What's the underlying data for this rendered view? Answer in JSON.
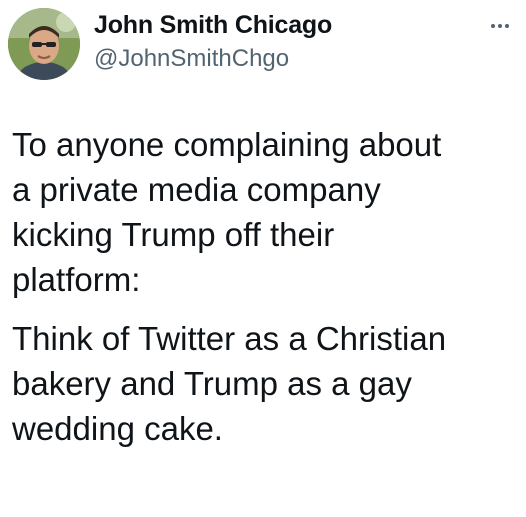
{
  "author": {
    "display_name": "John Smith Chicago",
    "handle": "@JohnSmithChgo",
    "avatar_icon": "profile-photo"
  },
  "more_icon": "more-dots-icon",
  "tweet": {
    "paragraph_1": "To anyone complaining about\na private media company\nkicking Trump off their\nplatform:",
    "paragraph_2": "Think of Twitter as a Christian\nbakery and Trump as a gay\nwedding cake."
  },
  "colors": {
    "text_primary": "#0f1419",
    "text_secondary": "#536471",
    "background": "#ffffff"
  }
}
